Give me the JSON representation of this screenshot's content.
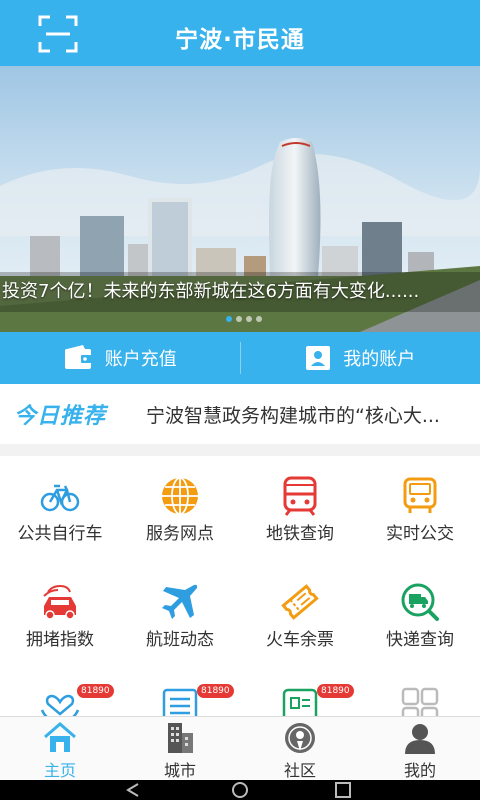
{
  "header": {
    "title": "宁波·市民通",
    "scan_icon": "scan-icon"
  },
  "banner": {
    "caption": "投资7个亿！未来的东部新城在这6方面有大变化......",
    "slide_count": 4,
    "active_slide": 1
  },
  "account": {
    "recharge_label": "账户充值",
    "my_account_label": "我的账户"
  },
  "recommend": {
    "label": "今日推荐",
    "headline": "宁波智慧政务构建城市的“核心大..."
  },
  "services": [
    {
      "label": "公共自行车",
      "icon": "bicycle-icon"
    },
    {
      "label": "服务网点",
      "icon": "globe-icon"
    },
    {
      "label": "地铁查询",
      "icon": "metro-icon"
    },
    {
      "label": "实时公交",
      "icon": "bus-icon"
    },
    {
      "label": "拥堵指数",
      "icon": "traffic-car-icon"
    },
    {
      "label": "航班动态",
      "icon": "airplane-icon"
    },
    {
      "label": "火车余票",
      "icon": "train-ticket-icon"
    },
    {
      "label": "快递查询",
      "icon": "express-search-icon"
    },
    {
      "label": "",
      "icon": "heart-hands-icon",
      "badge": "81890"
    },
    {
      "label": "",
      "icon": "list-icon",
      "badge": "81890"
    },
    {
      "label": "",
      "icon": "card-icon",
      "badge": "81890"
    },
    {
      "label": "",
      "icon": "apps-grid-icon"
    }
  ],
  "tabs": [
    {
      "label": "主页",
      "icon": "home-icon",
      "active": true
    },
    {
      "label": "城市",
      "icon": "city-icon",
      "active": false
    },
    {
      "label": "社区",
      "icon": "community-icon",
      "active": false
    },
    {
      "label": "我的",
      "icon": "user-icon",
      "active": false
    }
  ],
  "colors": {
    "primary": "#38b2ec",
    "orange": "#f39c12",
    "red": "#e53935",
    "green": "#1aa260"
  }
}
